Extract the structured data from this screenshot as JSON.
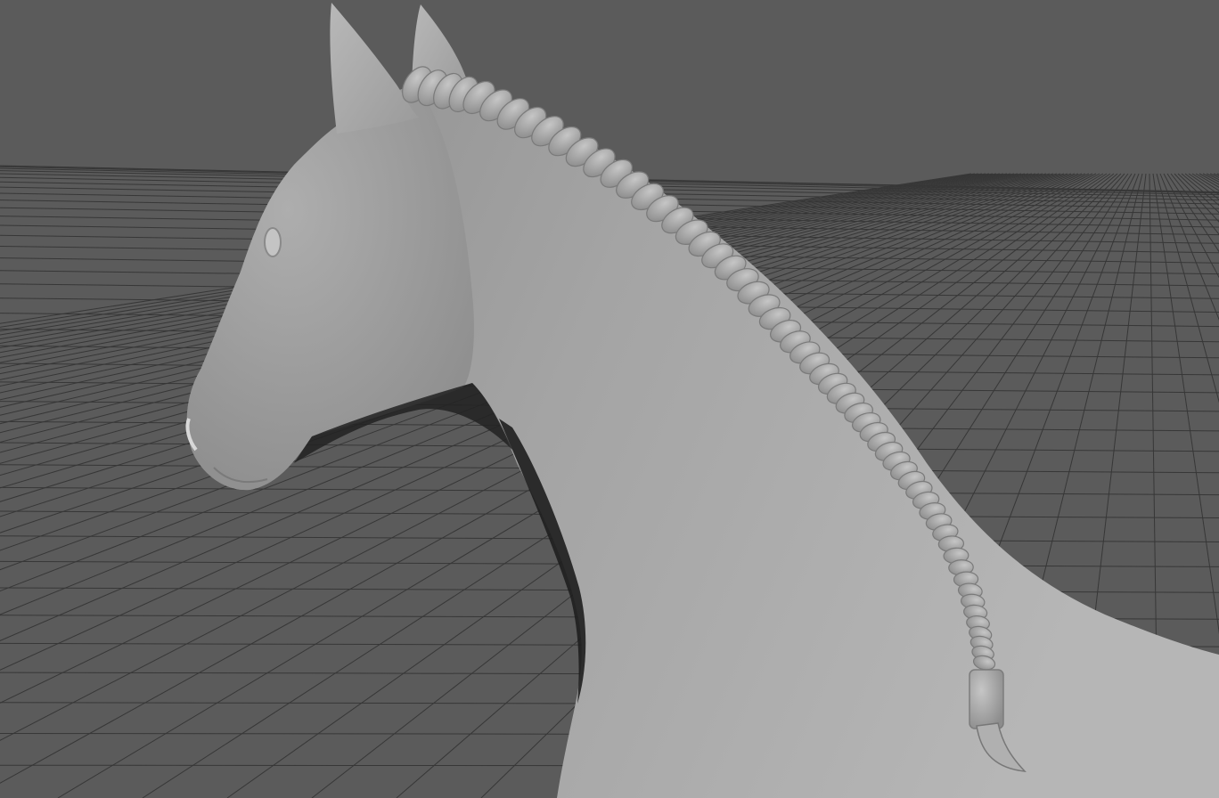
{
  "viewport": {
    "background_color": "#5b5b5b",
    "grid_color": "#373737",
    "model_color": "#a9a9a9",
    "model_shadow_color": "#7f7f7f",
    "braid_color": "#b4b4b4",
    "shading": "smooth-shaded",
    "model": "horse-head-and-neck",
    "model_feature": "braided-mane",
    "grid_visible": true
  }
}
